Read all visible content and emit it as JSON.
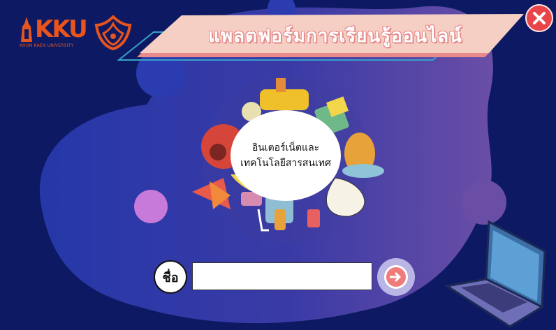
{
  "header": {
    "logo_text": "KKU",
    "logo_subtext": "KHON KAEN UNIVERSITY",
    "title": "แพลตฟอร์มการเรียนรู้ออนไลน์"
  },
  "center": {
    "line1": "อินเตอร์เน็ตและ",
    "line2": "เทคโนโลยีสารสนเทศ"
  },
  "form": {
    "name_label": "ชื่อ",
    "name_value": "",
    "name_placeholder": ""
  },
  "icons": {
    "close": "close-icon",
    "next": "arrow-right-icon"
  },
  "colors": {
    "background": "#0d1a63",
    "accent_orange": "#e8541c",
    "close_red": "#e8454a",
    "title_banner": "#f6cfc4"
  }
}
